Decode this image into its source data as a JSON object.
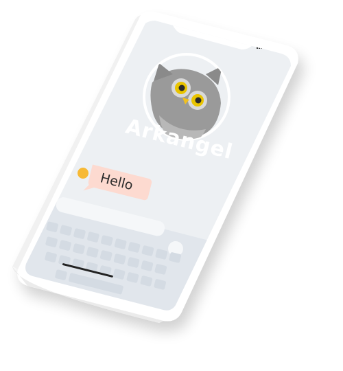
{
  "app": {
    "name": "Arkangel",
    "mascot_icon": "owl-icon"
  },
  "chat": {
    "message": "Hello",
    "sender_avatar_color": "#f7b934",
    "bubble_color": "#fddad0"
  },
  "status_bar": {
    "icons": [
      "signal-icon",
      "wifi-icon",
      "battery-icon"
    ]
  },
  "keyboard": {
    "input_value": "",
    "rows": [
      10,
      9,
      9,
      4
    ]
  },
  "colors": {
    "screen_bg": "#edf0f3",
    "frame": "#ffffff",
    "owl_body": "#8e8e8e",
    "owl_eye": "#e9c400",
    "keyboard_bg": "#e1e6ec",
    "key": "#d4dbe3"
  }
}
